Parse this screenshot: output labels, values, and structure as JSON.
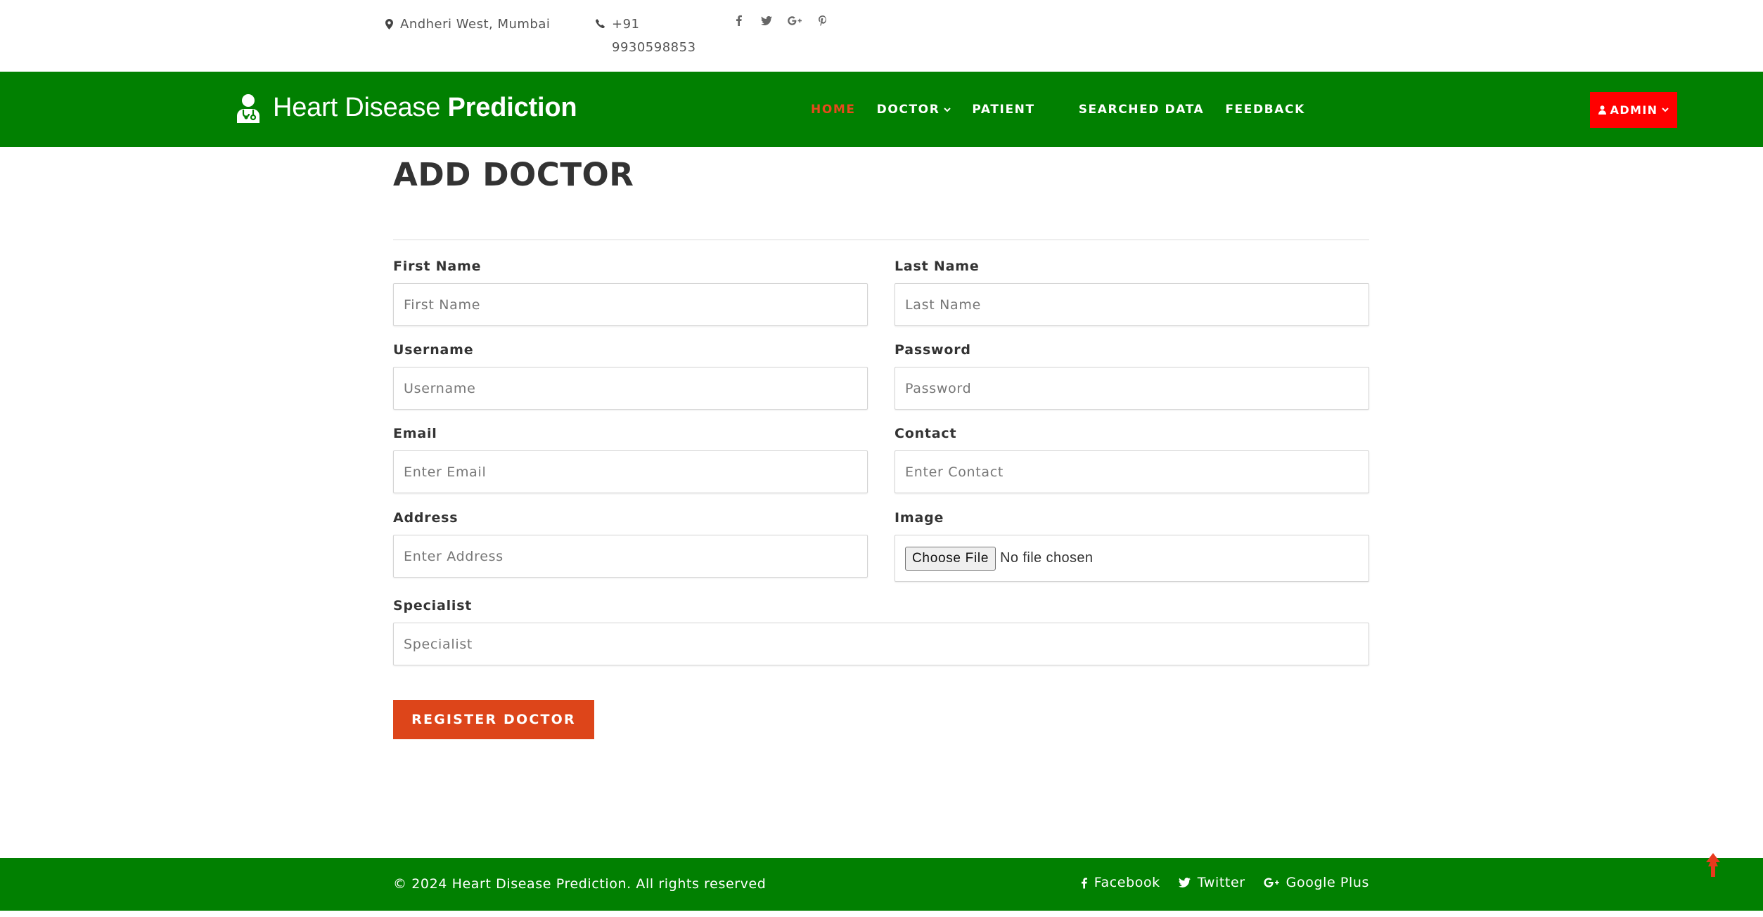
{
  "topbar": {
    "address": "Andheri West, Mumbai",
    "phone": "+91 9930598853",
    "social_icons": [
      "facebook-icon",
      "twitter-icon",
      "google-plus-icon",
      "pinterest-icon"
    ]
  },
  "navbar": {
    "brand_light": "Heart Disease",
    "brand_bold": "Prediction",
    "items": [
      {
        "label": "HOME",
        "active": true
      },
      {
        "label": "DOCTOR",
        "dropdown": true
      },
      {
        "label": "PATIENT"
      },
      {
        "label": "SEARCHED DATA"
      },
      {
        "label": "FEEDBACK"
      }
    ],
    "admin_label": "ADMIN"
  },
  "page": {
    "title": "ADD DOCTOR"
  },
  "form": {
    "first_name": {
      "label": "First Name",
      "placeholder": "First Name"
    },
    "last_name": {
      "label": "Last Name",
      "placeholder": "Last Name"
    },
    "username": {
      "label": "Username",
      "placeholder": "Username"
    },
    "password": {
      "label": "Password",
      "placeholder": "Password"
    },
    "email": {
      "label": "Email",
      "placeholder": "Enter Email"
    },
    "contact": {
      "label": "Contact",
      "placeholder": "Enter Contact"
    },
    "address": {
      "label": "Address",
      "placeholder": "Enter Address"
    },
    "image": {
      "label": "Image",
      "button": "Choose File",
      "status": "No file chosen"
    },
    "specialist": {
      "label": "Specialist",
      "placeholder": "Specialist"
    },
    "submit_label": "REGISTER DOCTOR"
  },
  "footer": {
    "copyright": "© 2024 Heart Disease Prediction. All rights reserved",
    "links": [
      {
        "label": "Facebook",
        "icon": "facebook-icon"
      },
      {
        "label": "Twitter",
        "icon": "twitter-icon"
      },
      {
        "label": "Google Plus",
        "icon": "google-plus-icon"
      }
    ]
  },
  "colors": {
    "nav_green": "#018001",
    "accent_orange": "#dd451a",
    "admin_red": "#ff0000",
    "active_link": "#e8491d"
  }
}
